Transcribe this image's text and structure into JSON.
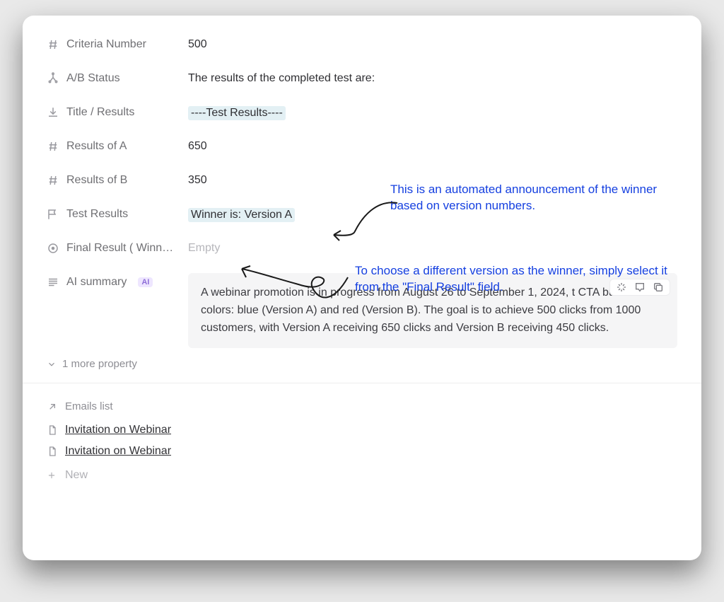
{
  "properties": {
    "criteria_number": {
      "label": "Criteria Number",
      "value": "500"
    },
    "ab_status": {
      "label": "A/B Status",
      "value": "The results of the completed test are:"
    },
    "title_results": {
      "label": "Title / Results",
      "value": "----Test Results----"
    },
    "results_a": {
      "label": "Results of A",
      "value": "650"
    },
    "results_b": {
      "label": "Results of B",
      "value": "350"
    },
    "test_results": {
      "label": "Test Results",
      "value": "Winner is: Version A"
    },
    "final_result": {
      "label": "Final Result ( Winn…",
      "value": "Empty"
    },
    "ai_summary": {
      "label": "AI summary",
      "pill": "AI",
      "value": "A webinar promotion is in progress from August 26 to September 1, 2024, t         CTA button colors: blue (Version A) and red (Version B). The goal is to achieve 500 clicks from 1000 customers, with Version A receiving 650 clicks and Version B receiving 450 clicks."
    }
  },
  "more_text": "1 more property",
  "emails_header": "Emails list",
  "emails": [
    "Invitation on Webinar",
    "Invitation on Webinar"
  ],
  "new_label": "New",
  "annotations": {
    "a": "This is an automated announcement of the winner based on version numbers.",
    "b": "To choose a different version as the winner, simply select it from the \"Final Result\" field."
  }
}
